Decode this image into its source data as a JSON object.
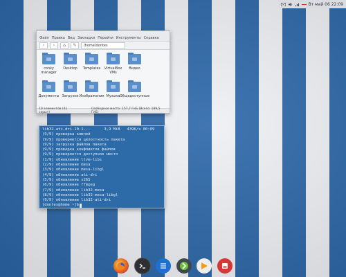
{
  "top_panel": {
    "clock": "Вт май 06 22:09",
    "icons": [
      "mail-icon",
      "volume-icon",
      "network-icon",
      "keyboard-flag-icon"
    ]
  },
  "file_manager": {
    "menu": [
      "Файл",
      "Правка",
      "Вид",
      "Закладки",
      "Перейти",
      "Инструменты",
      "Справка"
    ],
    "path": "/home/dontes",
    "items": [
      {
        "label": "conky manager"
      },
      {
        "label": "Desktop"
      },
      {
        "label": "Templates"
      },
      {
        "label": "VirtualBox VMs"
      },
      {
        "label": "Видео"
      },
      {
        "label": "Документы"
      },
      {
        "label": "Загрузки"
      },
      {
        "label": "Изображения"
      },
      {
        "label": "Музыка"
      },
      {
        "label": "Общедоступные"
      }
    ],
    "status_left": "10 элементов (41 скрыт)",
    "status_right": "Свободное место: 157,7 ГиБ (Всего: 189,5 ГиБ)"
  },
  "terminal": {
    "lines": [
      "lib32-ati-dri-10.1...      3,9 MiB   439K/s 00:09",
      "(9/9) проверка ключей",
      "(9/9) проверяется целостность пакета",
      "(9/9) загрузка файлов пакета",
      "(9/9) проверка конфликтов файлов",
      "(9/9) проверяется доступное место",
      "(1/9) обновление llvm-libs",
      "(2/9) обновление mesa",
      "(3/9) обновление mesa-libgl",
      "(4/9) обновление ati-dri",
      "(5/9) обновление x265",
      "(6/9) обновление ffmpeg",
      "(7/9) обновление lib32-mesa",
      "(8/9) обновление lib32-mesa-libgl",
      "(9/9) обновление lib32-ati-dri"
    ],
    "prompt": "[dontes@home ~]$"
  },
  "dock": {
    "apps": [
      "firefox-icon",
      "terminal-icon",
      "notes-icon",
      "torrent-icon",
      "media-player-icon",
      "disk-icon"
    ]
  },
  "colors": {
    "stripe_blue": "#2a66a8",
    "stripe_white": "#eef0f3",
    "terminal_bg": "#2c6aa8",
    "folder": "#5b8fc9"
  }
}
